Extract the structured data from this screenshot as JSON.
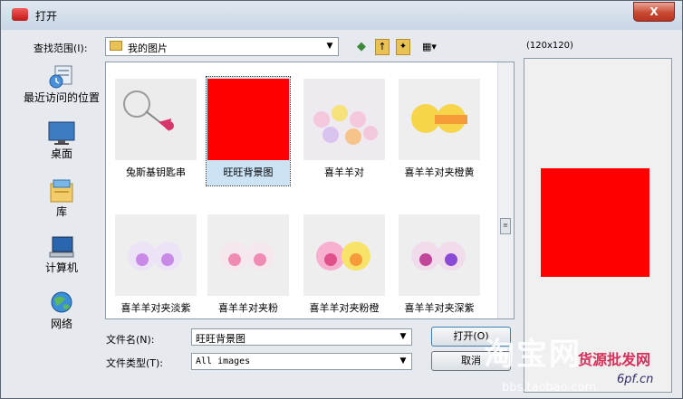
{
  "window": {
    "title": "打开",
    "close_label": "X"
  },
  "lookin": {
    "label": "查找范围(I):",
    "value": "我的图片"
  },
  "toolbar": {
    "back_glyph": "◆",
    "up_glyph": "↑",
    "newfolder_glyph": "✦",
    "views_glyph": "▦▾"
  },
  "places": [
    {
      "label": "最近访问的位置",
      "icon": "recent-places-icon"
    },
    {
      "label": "桌面",
      "icon": "desktop-icon"
    },
    {
      "label": "库",
      "icon": "library-icon"
    },
    {
      "label": "计算机",
      "icon": "computer-icon"
    },
    {
      "label": "网络",
      "icon": "network-icon"
    }
  ],
  "files": [
    {
      "name": "兔斯基钥匙串",
      "selected": false
    },
    {
      "name": "旺旺背景图",
      "selected": true
    },
    {
      "name": "喜羊羊对",
      "selected": false
    },
    {
      "name": "喜羊羊对夹橙黄",
      "selected": false
    },
    {
      "name": "喜羊羊对夹淡紫",
      "selected": false
    },
    {
      "name": "喜羊羊对夹粉",
      "selected": false
    },
    {
      "name": "喜羊羊对夹粉橙",
      "selected": false
    },
    {
      "name": "喜羊羊对夹深紫",
      "selected": false
    }
  ],
  "preview": {
    "size_label": "(120x120)",
    "color": "#ff0000"
  },
  "filename": {
    "label": "文件名(N):",
    "value": "旺旺背景图"
  },
  "filetype": {
    "label": "文件类型(T):",
    "value": "All images"
  },
  "buttons": {
    "open": "打开(O)",
    "cancel": "取消"
  },
  "watermark": {
    "logo": "淘宝网",
    "url": "bbs.taobao.com",
    "cn": "货源批发网",
    "site": "6pf.cn"
  },
  "colors": {
    "accent": "#cce3f6",
    "selected_image": "#ff0000",
    "close": "#c84a33"
  }
}
